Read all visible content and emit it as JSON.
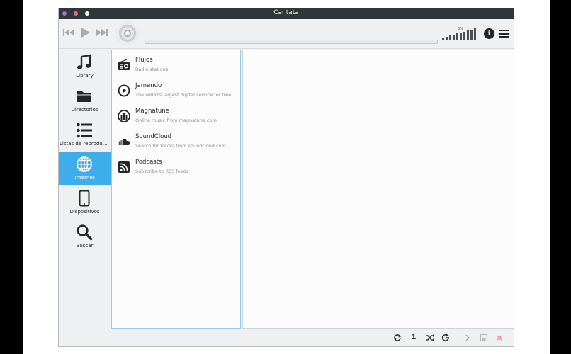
{
  "window": {
    "title": "Cantata",
    "dots": [
      "#9b6fd6",
      "#e06c8c",
      "#ffffff"
    ]
  },
  "toolbar": {
    "prev_icon": "skip-back-icon",
    "play_icon": "play-icon",
    "next_icon": "skip-forward-icon",
    "cover_icon": "disc-icon",
    "volume_percent": "0%",
    "volume_level": 1.0,
    "info_icon": "info-icon",
    "menu_icon": "hamburger-menu-icon"
  },
  "sidebar": {
    "items": [
      {
        "label": "Library",
        "icon": "music-note-icon"
      },
      {
        "label": "Directorios",
        "icon": "folder-icon"
      },
      {
        "label": "Listas de reproducción",
        "icon": "playlist-icon"
      },
      {
        "label": "Internet",
        "icon": "globe-icon",
        "active": true
      },
      {
        "label": "Dispositivos",
        "icon": "phone-icon"
      },
      {
        "label": "Buscar",
        "icon": "search-icon"
      }
    ]
  },
  "services": [
    {
      "name": "Flujos",
      "desc": "Radio stations",
      "icon": "radio-icon"
    },
    {
      "name": "Jamendo",
      "desc": "The world's largest digital service for free music",
      "icon": "play-circle-icon"
    },
    {
      "name": "Magnatune",
      "desc": "Online music from magnatune.com",
      "icon": "magnatune-icon"
    },
    {
      "name": "SoundCloud",
      "desc": "Search for tracks from soundcloud.com",
      "icon": "soundcloud-icon"
    },
    {
      "name": "Podcasts",
      "desc": "Subscribe to RSS feeds",
      "icon": "rss-icon"
    }
  ],
  "bottombar": {
    "repeat_icon": "repeat-icon",
    "single_label": "1",
    "shuffle_icon": "shuffle-icon",
    "consume_icon": "consume-icon",
    "forward_icon": "chevron-right-icon",
    "save_icon": "save-icon",
    "clear_icon": "close-icon"
  }
}
